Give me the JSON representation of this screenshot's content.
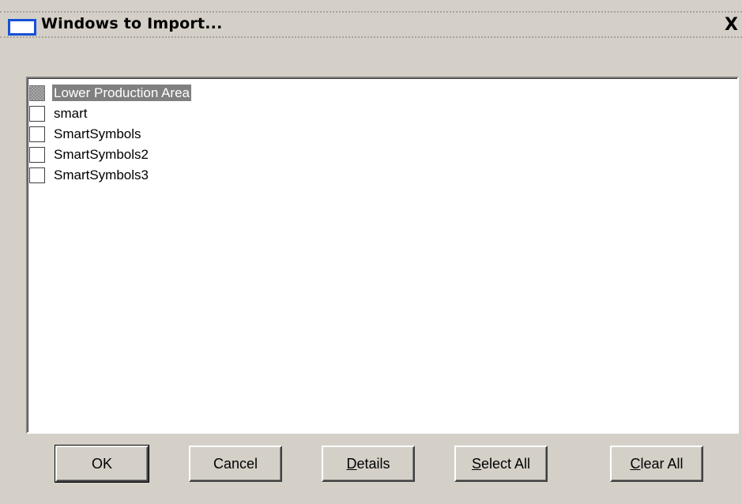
{
  "window": {
    "title": "Windows to Import...",
    "close_glyph": "X",
    "icon": "window-icon"
  },
  "list": {
    "items": [
      {
        "label": "Lower Production Area",
        "state": "indeterminate",
        "selected": true
      },
      {
        "label": "smart",
        "state": "unchecked",
        "selected": false
      },
      {
        "label": "SmartSymbols",
        "state": "unchecked",
        "selected": false
      },
      {
        "label": "SmartSymbols2",
        "state": "unchecked",
        "selected": false
      },
      {
        "label": "SmartSymbols3",
        "state": "unchecked",
        "selected": false
      }
    ]
  },
  "buttons": {
    "ok": {
      "label": "OK",
      "mnemonic": "",
      "rest": "OK"
    },
    "cancel": {
      "label": "Cancel",
      "mnemonic": "",
      "rest": "Cancel"
    },
    "details": {
      "label": "Details",
      "mnemonic": "D",
      "rest": "etails"
    },
    "select_all": {
      "label": "Select All",
      "mnemonic": "S",
      "rest": "elect All"
    },
    "clear_all": {
      "label": "Clear All",
      "mnemonic": "C",
      "rest": "lear All"
    }
  },
  "colors": {
    "dialog_bg": "#d4d0c8",
    "title_icon_border": "#1550d8",
    "selection_bg": "#808080",
    "selection_text": "#ffffff"
  }
}
